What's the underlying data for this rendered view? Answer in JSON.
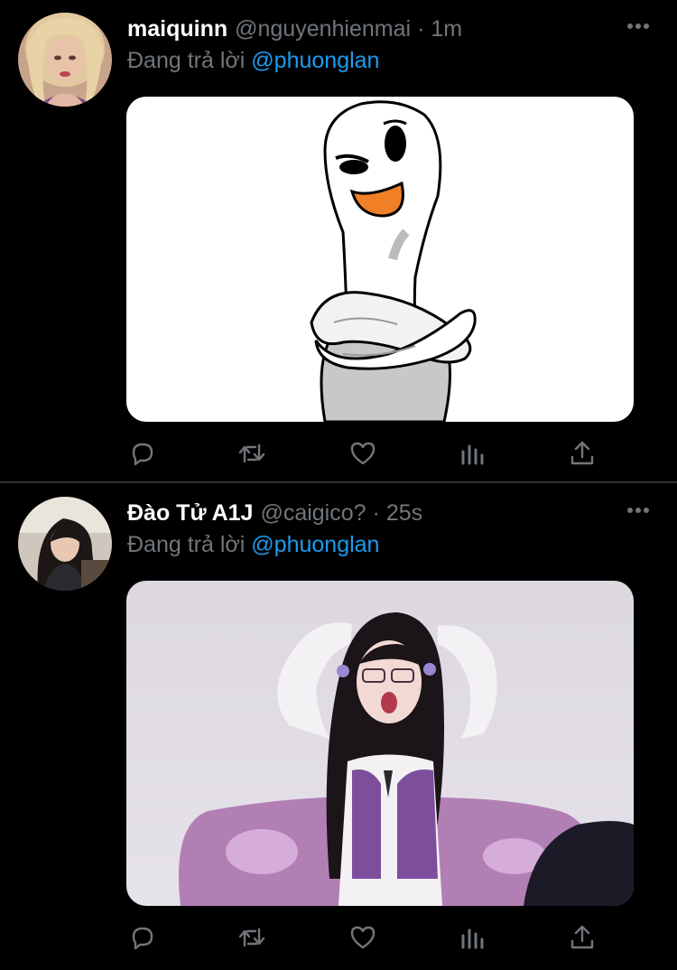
{
  "tweets": [
    {
      "display_name": "maiquinn",
      "handle": "@nguyenhienmai",
      "separator": "·",
      "time": "1m",
      "reply_prefix": "Đang trả lời",
      "reply_to": "@phuonglan",
      "avatar": "avatar-blonde-woman",
      "media": "white-cartoon-character-arms-crossed"
    },
    {
      "display_name": "Đào Tử A1J",
      "handle": "@caigico?",
      "separator": "·",
      "time": "25s",
      "reply_prefix": "Đang trả lời",
      "reply_to": "@phuonglan",
      "avatar": "avatar-dark-hair-woman",
      "media": "woman-with-glasses-hands-on-head"
    }
  ],
  "actions": [
    "reply-icon",
    "retweet-icon",
    "like-icon",
    "analytics-icon",
    "share-icon"
  ],
  "colors": {
    "background": "#000000",
    "text": "#ffffff",
    "muted": "#71767b",
    "link": "#1d9bf0",
    "divider": "#2f3336"
  }
}
